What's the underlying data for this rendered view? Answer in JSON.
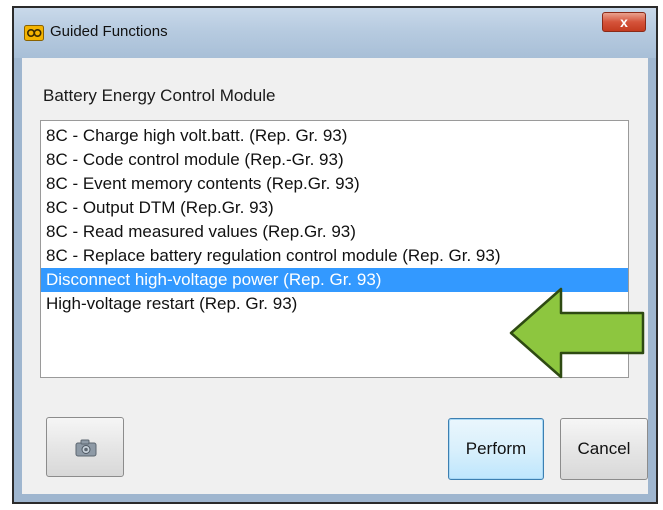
{
  "window": {
    "title": "Guided Functions",
    "close_label": "x"
  },
  "module": {
    "label": "Battery Energy Control Module"
  },
  "list": {
    "items": [
      "8C - Charge high volt.batt. (Rep. Gr. 93)",
      "8C - Code control module (Rep.-Gr. 93)",
      "8C - Event memory contents (Rep.Gr. 93)",
      "8C - Output DTM (Rep.Gr. 93)",
      "8C - Read measured values (Rep.Gr. 93)",
      "8C - Replace battery regulation control module (Rep. Gr. 93)",
      "Disconnect high-voltage power (Rep. Gr. 93)",
      "High-voltage restart (Rep. Gr. 93)"
    ],
    "selected_index": 6,
    "selection_color": "#3399ff"
  },
  "annotation": {
    "arrow_color": "#8dc63f",
    "arrow_direction": "left"
  },
  "buttons": {
    "camera_icon": "camera-icon",
    "perform_label": "Perform",
    "cancel_label": "Cancel"
  }
}
